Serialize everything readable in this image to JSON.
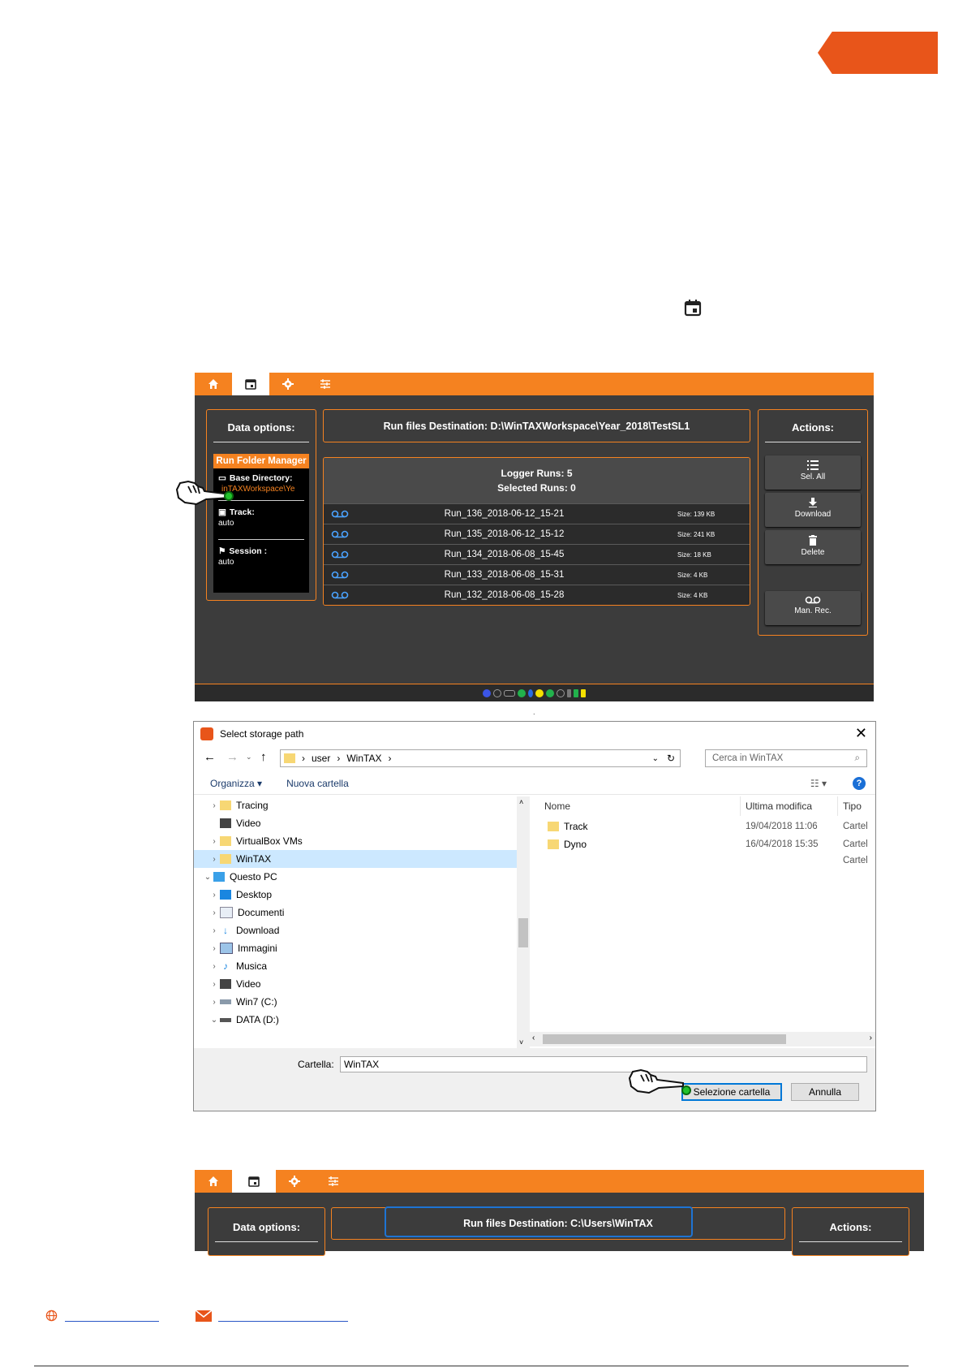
{
  "colors": {
    "accent": "#f58220",
    "brand_tab": "#e8551a",
    "panel_bg": "#3c3c3c",
    "highlight": "#1e74d4",
    "link": "#2a56c6"
  },
  "doc": {
    "calendar_icon": "calendar-icon",
    "dot_label": "."
  },
  "app1": {
    "tabs": [
      "home-icon",
      "calendar-icon",
      "gear-icon",
      "sliders-icon"
    ],
    "data_options_title": "Data options:",
    "run_folder_manager": "Run Folder Manager",
    "base_directory_label": "Base Directory:",
    "base_directory_value": "inTAXWorkspace\\Ye",
    "track_label": "Track:",
    "track_value": "auto",
    "session_label": "Session :",
    "session_value": "auto",
    "destination": "Run files Destination:   D:\\WinTAXWorkspace\\Year_2018\\TestSL1",
    "logger_runs": "Logger Runs: 5",
    "selected_runs": "Selected Runs: 0",
    "runs": [
      {
        "name": "Run_136_2018-06-12_15-21",
        "size": "Size: 139 KB"
      },
      {
        "name": "Run_135_2018-06-12_15-12",
        "size": "Size: 241 KB"
      },
      {
        "name": "Run_134_2018-06-08_15-45",
        "size": "Size: 18 KB"
      },
      {
        "name": "Run_133_2018-06-08_15-31",
        "size": "Size: 4 KB"
      },
      {
        "name": "Run_132_2018-06-08_15-28",
        "size": "Size: 4 KB"
      }
    ],
    "actions_title": "Actions:",
    "actions": [
      {
        "label": "Sel. All",
        "icon": "list-icon"
      },
      {
        "label": "Download",
        "icon": "download-icon"
      },
      {
        "label": "Delete",
        "icon": "trash-icon"
      },
      {
        "label": "Man. Rec.",
        "icon": "voicemail-icon"
      }
    ]
  },
  "dialog": {
    "title": "Select storage path",
    "breadcrumb": [
      "user",
      "WinTAX"
    ],
    "search_placeholder": "Cerca in WinTAX",
    "organize": "Organizza",
    "new_folder": "Nuova cartella",
    "tree": [
      {
        "label": "Tracing",
        "icon": "folder",
        "chev": ">",
        "indent": 1
      },
      {
        "label": "Video",
        "icon": "film",
        "chev": "",
        "indent": 1
      },
      {
        "label": "VirtualBox VMs",
        "icon": "folder",
        "chev": ">",
        "indent": 1
      },
      {
        "label": "WinTAX",
        "icon": "folder",
        "chev": ">",
        "indent": 1,
        "selected": true
      },
      {
        "label": "Questo PC",
        "icon": "pc",
        "chev": "v",
        "indent": 0
      },
      {
        "label": "Desktop",
        "icon": "desktop",
        "chev": ">",
        "indent": 1
      },
      {
        "label": "Documenti",
        "icon": "doc",
        "chev": ">",
        "indent": 1
      },
      {
        "label": "Download",
        "icon": "down",
        "chev": ">",
        "indent": 1
      },
      {
        "label": "Immagini",
        "icon": "img",
        "chev": ">",
        "indent": 1
      },
      {
        "label": "Musica",
        "icon": "music",
        "chev": ">",
        "indent": 1
      },
      {
        "label": "Video",
        "icon": "film",
        "chev": ">",
        "indent": 1
      },
      {
        "label": "Win7 (C:)",
        "icon": "drive",
        "chev": ">",
        "indent": 1
      },
      {
        "label": "DATA (D:)",
        "icon": "drive2",
        "chev": "v",
        "indent": 1
      }
    ],
    "col_name": "Nome",
    "col_modified": "Ultima modifica",
    "col_type": "Tipo",
    "files": [
      {
        "name": "Track",
        "modified": "19/04/2018 11:06",
        "type": "Cartel"
      },
      {
        "name": "Dyno",
        "modified": "16/04/2018 15:35",
        "type": "Cartel"
      },
      {
        "name": "",
        "modified": "",
        "type": "Cartel"
      }
    ],
    "folder_label": "Cartella:",
    "folder_value": "WinTAX",
    "select_button": "Selezione cartella",
    "cancel_button": "Annulla"
  },
  "app2": {
    "data_options_title": "Data options:",
    "destination": "Run files Destination:    C:\\Users\\WinTAX",
    "actions_title": "Actions:"
  }
}
